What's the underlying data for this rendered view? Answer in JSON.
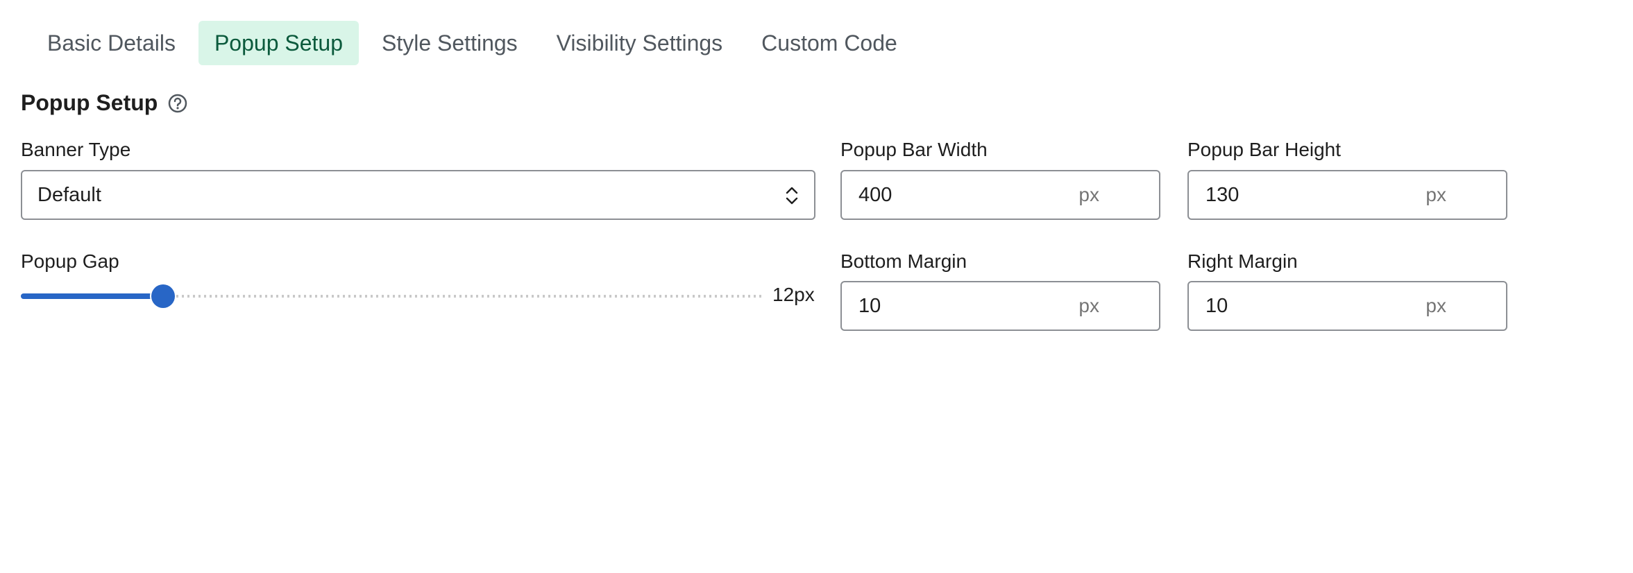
{
  "tabs": [
    {
      "label": "Basic Details",
      "active": false
    },
    {
      "label": "Popup Setup",
      "active": true
    },
    {
      "label": "Style Settings",
      "active": false
    },
    {
      "label": "Visibility Settings",
      "active": false
    },
    {
      "label": "Custom Code",
      "active": false
    }
  ],
  "section": {
    "title": "Popup Setup",
    "help_icon": "question-circle-icon"
  },
  "banner_type": {
    "label": "Banner Type",
    "value": "Default"
  },
  "popup_gap": {
    "label": "Popup Gap",
    "value": 12,
    "value_text": "12px",
    "min": 0,
    "max": 100
  },
  "popup_bar_width": {
    "label": "Popup Bar Width",
    "value": "400",
    "unit": "px"
  },
  "popup_bar_height": {
    "label": "Popup Bar Height",
    "value": "130",
    "unit": "px"
  },
  "bottom_margin": {
    "label": "Bottom Margin",
    "value": "10",
    "unit": "px"
  },
  "right_margin": {
    "label": "Right Margin",
    "value": "10",
    "unit": "px"
  },
  "colors": {
    "accent": "#2866c6",
    "active_tab_bg": "#d9f5e8",
    "active_tab_text": "#0b5a3c"
  }
}
